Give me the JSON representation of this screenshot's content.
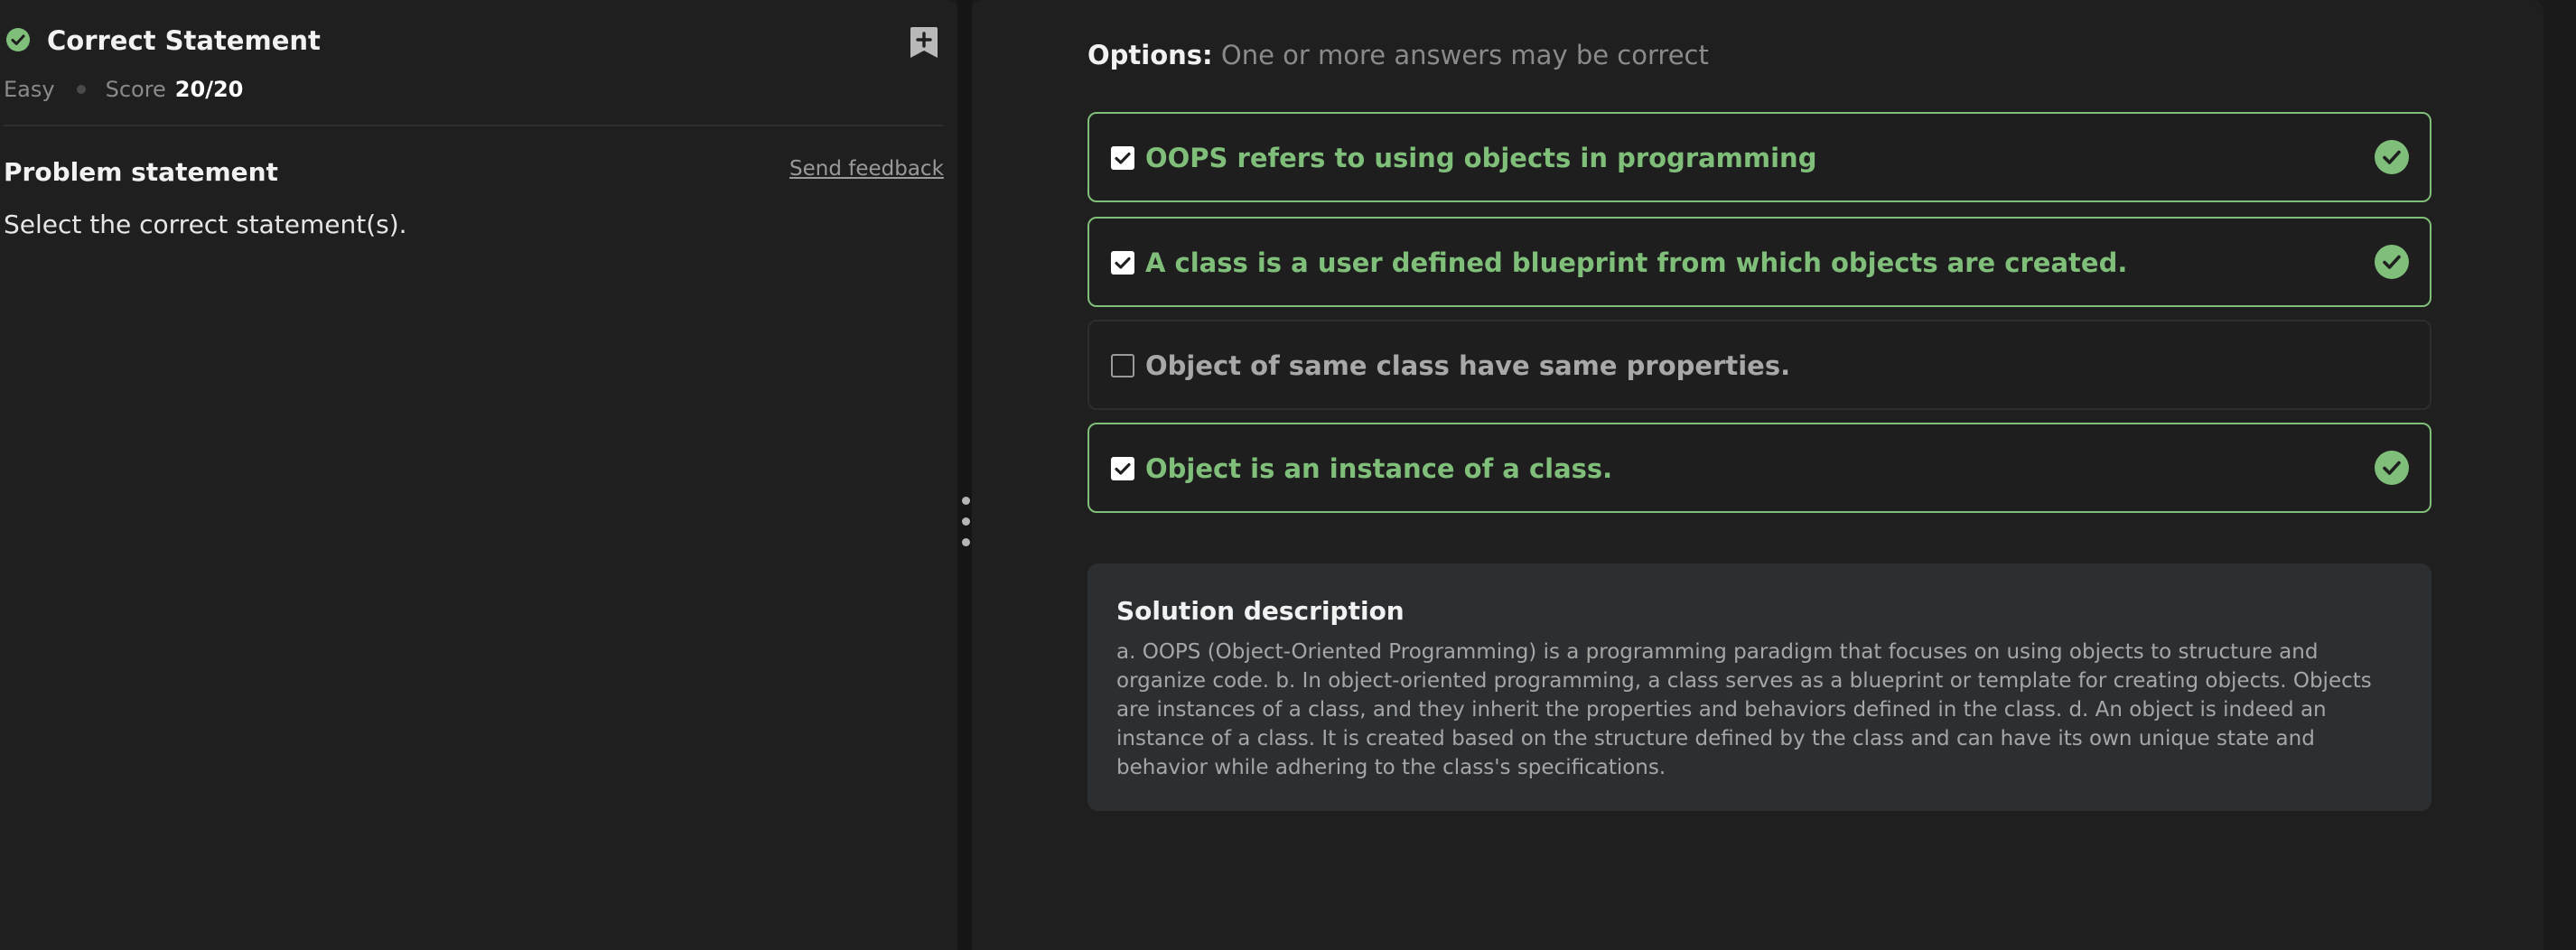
{
  "problem": {
    "title": "Correct Statement",
    "status_icon": "check-circle-icon",
    "difficulty": "Easy",
    "score_label": "Score",
    "score_value": "20/20",
    "bookmark_icon": "bookmark-add-icon"
  },
  "statement": {
    "heading": "Problem statement",
    "feedback_link": "Send feedback",
    "text": "Select the correct statement(s)."
  },
  "options_header": {
    "label": "Options:",
    "hint": "One or more answers may be correct"
  },
  "options": [
    {
      "text": "OOPS refers to using objects in programming",
      "checked": true,
      "correct": true
    },
    {
      "text": "A class is a user defined blueprint from which objects are created.",
      "checked": true,
      "correct": true
    },
    {
      "text": "Object of same class have same properties.",
      "checked": false,
      "correct": false
    },
    {
      "text": "Object is an instance of a class.",
      "checked": true,
      "correct": true
    }
  ],
  "solution": {
    "title": "Solution description",
    "text": "a. OOPS (Object-Oriented Programming) is a programming paradigm that focuses on using objects to structure and organize code. b. In object-oriented programming, a class serves as a blueprint or template for creating objects. Objects are instances of a class, and they inherit the properties and behaviors defined in the class. d. An object is indeed an instance of a class. It is created based on the structure defined by the class and can have its own unique state and behavior while adhering to the class's specifications."
  },
  "colors": {
    "correct_accent": "#7fbf7a",
    "panel_bg": "#1f1f1f",
    "solution_bg": "#2c2f31"
  }
}
